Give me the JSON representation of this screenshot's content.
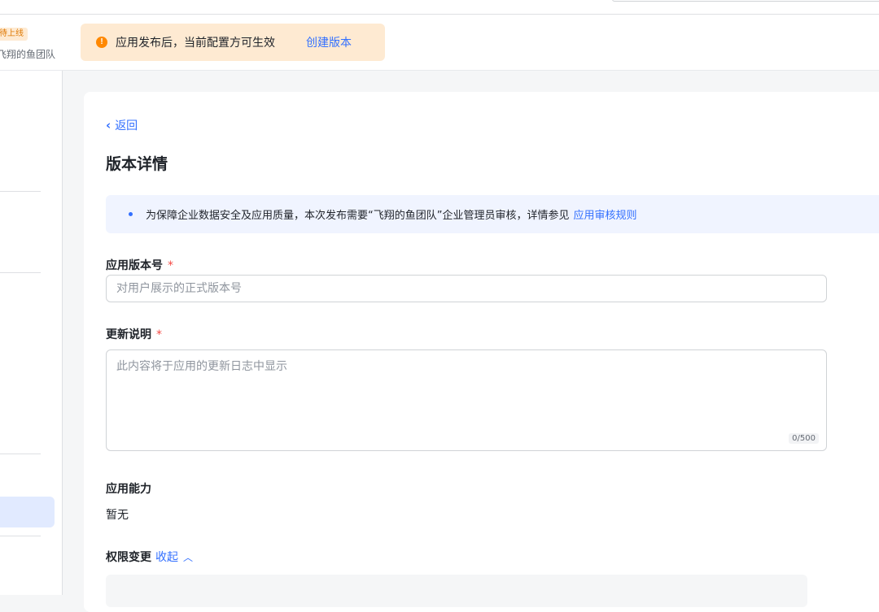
{
  "header": {
    "status_tag": "待上线",
    "team_name": "飞翔的鱼团队",
    "notice": {
      "text": "应用发布后，当前配置方可生效",
      "link": "创建版本",
      "icon": "exclamation-icon"
    }
  },
  "page": {
    "back_label": "返回",
    "title": "版本详情",
    "info": {
      "text": "为保障企业数据安全及应用质量，本次发布需要“飞翔的鱼团队”企业管理员审核，详情参见",
      "link": "应用审核规则"
    },
    "version_field": {
      "label": "应用版本号",
      "required_mark": "*",
      "placeholder": "对用户展示的正式版本号",
      "value": ""
    },
    "update_field": {
      "label": "更新说明",
      "required_mark": "*",
      "placeholder": "此内容将于应用的更新日志中显示",
      "value": "",
      "counter": "0/500"
    },
    "capabilities": {
      "label": "应用能力",
      "value": "暂无"
    },
    "permissions": {
      "label": "权限变更",
      "toggle": "收起"
    }
  },
  "colors": {
    "accent": "#3370ff",
    "warning": "#ff8800",
    "required": "#f54a45"
  }
}
